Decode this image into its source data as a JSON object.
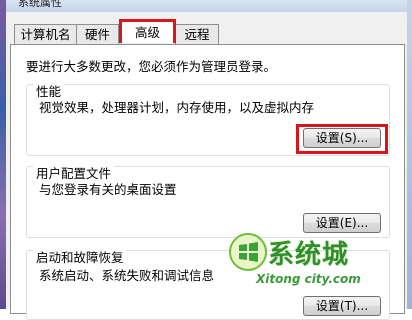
{
  "window": {
    "title": "系统属性"
  },
  "tabs": [
    {
      "label": "计算机名",
      "active": false
    },
    {
      "label": "硬件",
      "active": false
    },
    {
      "label": "高级",
      "active": true
    },
    {
      "label": "远程",
      "active": false
    }
  ],
  "admin_note": "要进行大多数更改，您必须作为管理员登录。",
  "groups": {
    "performance": {
      "title": "性能",
      "description": "视觉效果，处理器计划，内存使用，以及虚拟内存",
      "button": "设置(S)..."
    },
    "user_profiles": {
      "title": "用户配置文件",
      "description": "与您登录有关的桌面设置",
      "button": "设置(E)..."
    },
    "startup": {
      "title": "启动和故障恢复",
      "description": "系统启动、系统失败和调试信息",
      "button": "设置(T)..."
    }
  },
  "watermark": {
    "name": "系统城",
    "url": "Xitong city.com"
  },
  "colors": {
    "highlight": "#d8151a",
    "watermark": "#2f8f2f"
  }
}
